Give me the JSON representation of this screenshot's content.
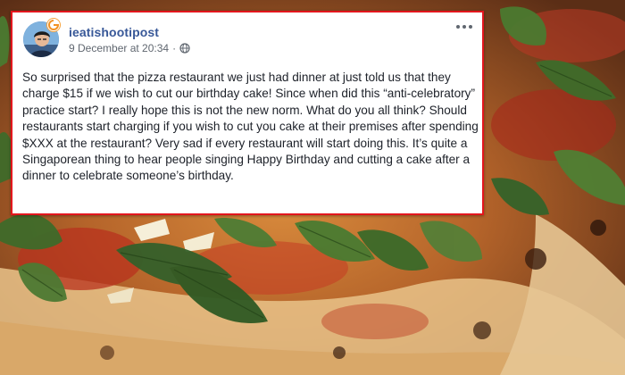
{
  "post": {
    "author": "ieatishootipost",
    "timestamp": "9 December at 20:34",
    "privacy_icon": "globe-icon",
    "more_icon": "more-options-icon",
    "border_color": "#e3161d",
    "author_color": "#385898",
    "body": "So surprised that the pizza restaurant we just had dinner at just told us that they charge $15 if we wish to cut our birthday cake! Since when did this “anti-celebratory” practice start? I really hope this is not the new norm. What do you all think? Should restaurants start charging if you wish to cut you cake at their premises after spending $XXX at the restaurant? Very sad if every restaurant will start doing this. It’s quite a Singaporean thing to hear people singing Happy Birthday and cutting a cake after a dinner to celebrate someone’s birthday."
  },
  "background": {
    "subject": "pizza-with-arugula-photo"
  }
}
